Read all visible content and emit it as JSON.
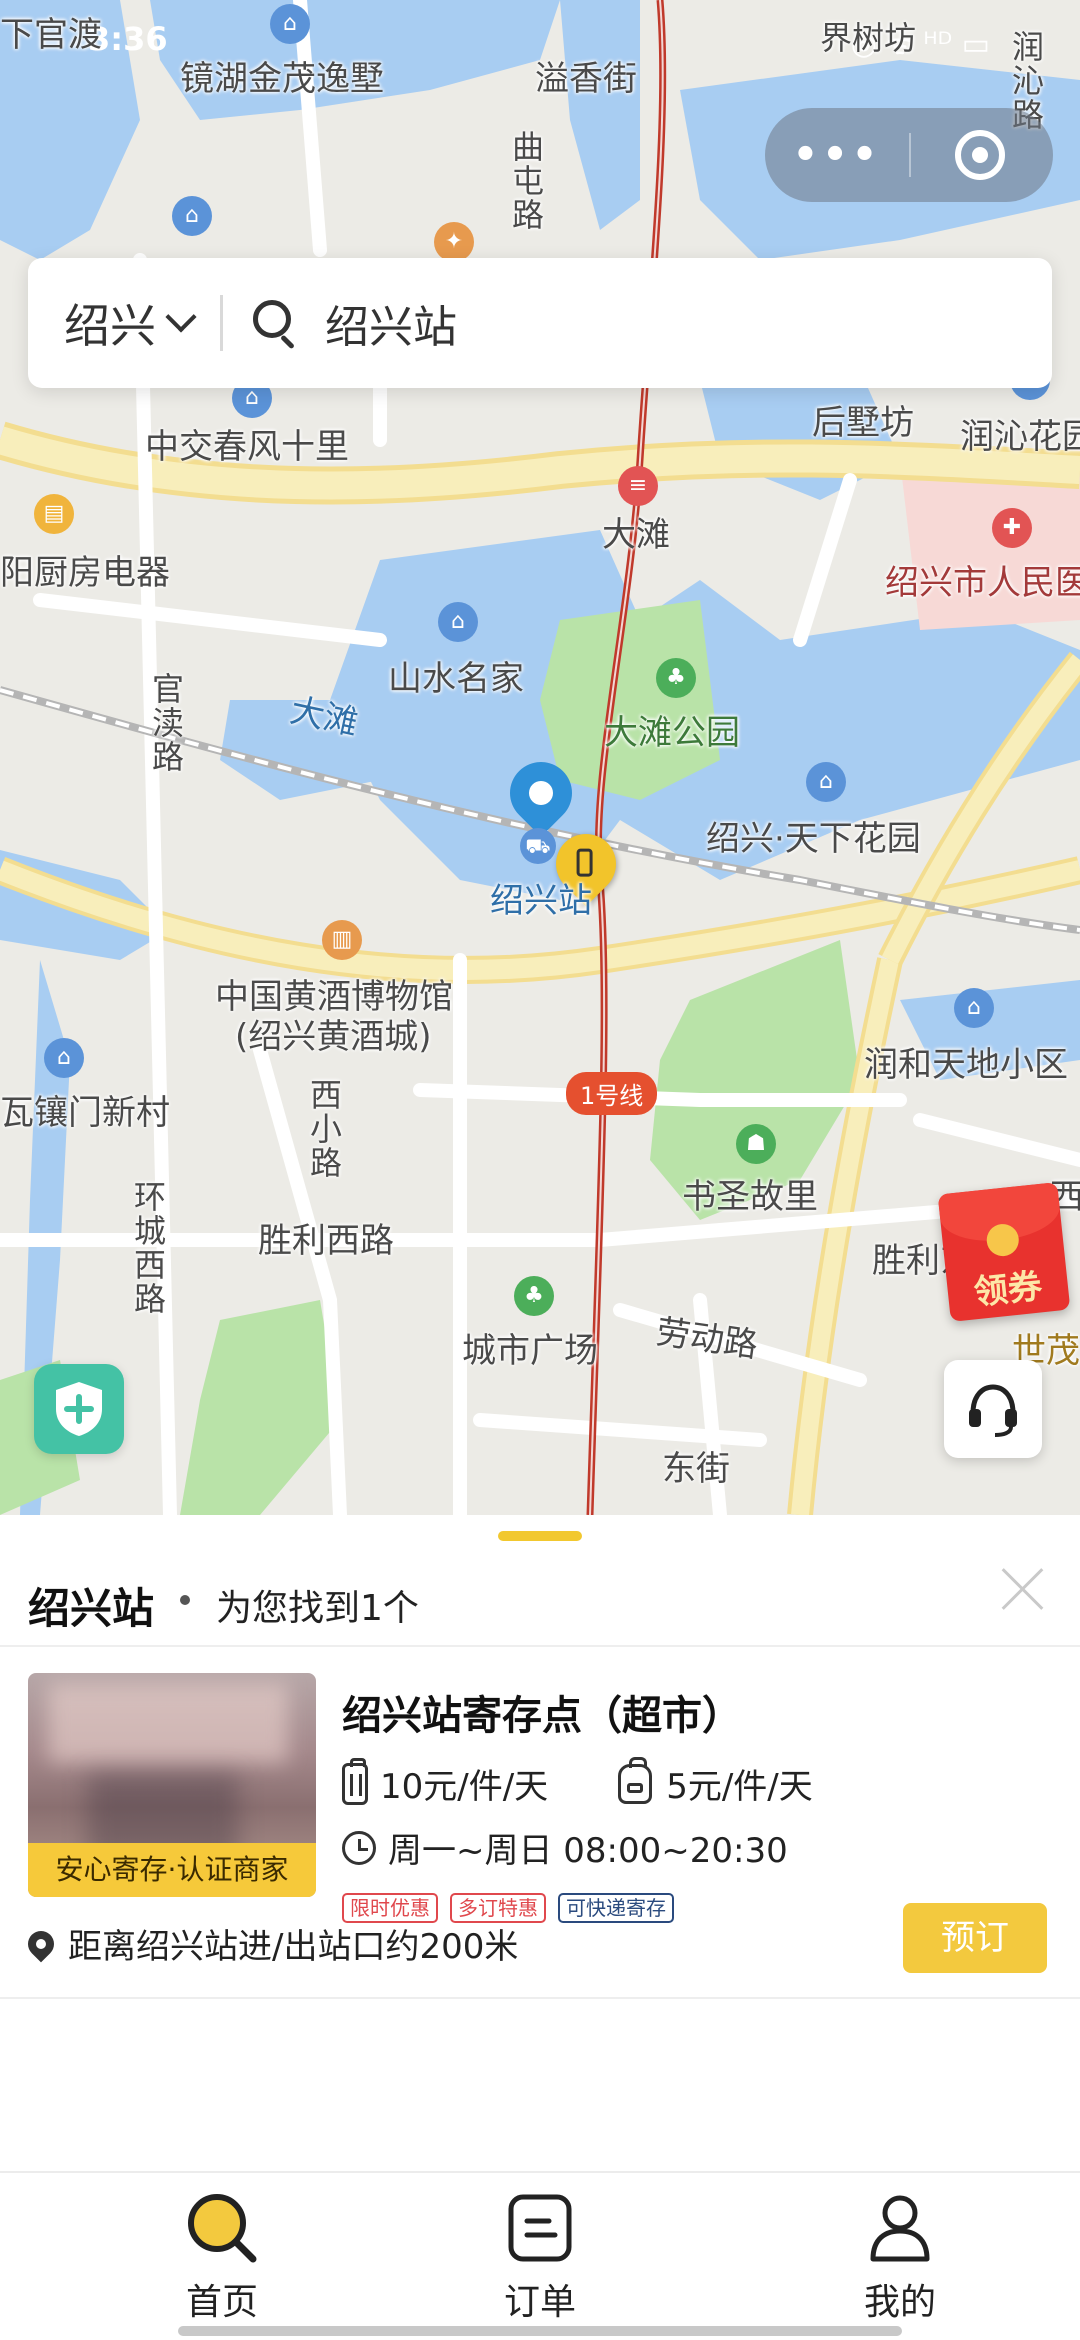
{
  "status_bar": {
    "time": "3:36",
    "icons": "◎ ᯤ ᴴᴰ ▭"
  },
  "capsule": {
    "more": "•••",
    "close_icon": "target-icon"
  },
  "search": {
    "city": "绍兴",
    "query": "绍兴站"
  },
  "map": {
    "labels": {
      "xiaguanshu": "下官渡",
      "jinghu": "镜湖金茂逸墅",
      "yixiangjie": "溢香街",
      "qutunlu": "曲屯路",
      "runqinlu": "润沁路",
      "jiecunfang": "界树坊",
      "zhongjiao": "中交春风十里",
      "houyefang": "后墅坊",
      "runqinhuayuan": "润沁花园",
      "datan_station": "大滩",
      "chufang": "阳厨房电器",
      "hospital": "绍兴市人民医院",
      "shanshui": "山水名家",
      "guandulu": "官渎路",
      "datan_water": "大滩",
      "datan_park": "大滩公园",
      "tianxia": "绍兴·天下花园",
      "shaoxing_station": "绍兴站",
      "museum1": "中国黄酒博物馆",
      "museum2": "(绍兴黄酒城)",
      "runhe": "润和天地小区",
      "yuanmen": "瓦镶门新村",
      "xixiaolu": "西小路",
      "line1": "1号线",
      "shushengguli": "书圣故里",
      "huanchengxilu": "环城西路",
      "shenglixilu": "胜利西路",
      "shengli": "胜利东",
      "shichang": "城市广场",
      "laodonglu": "劳动路",
      "dongjie": "东街",
      "shimao": "世茂",
      "xi": "西"
    }
  },
  "coupon": {
    "label": "领券"
  },
  "sheet": {
    "title": "绍兴站",
    "count_text": "为您找到1个",
    "results": [
      {
        "name": "绍兴站寄存点（超市）",
        "thumb_tag": "安心寄存·认证商家",
        "price_luggage": "10元/件/天",
        "price_bag": "5元/件/天",
        "hours": "周一~周日 08:00~20:30",
        "badges": [
          "限时优惠",
          "多订特惠",
          "可快递寄存"
        ],
        "distance": "距离绍兴站进/出站口约200米",
        "book_label": "预订"
      }
    ]
  },
  "tabs": [
    {
      "label": "首页",
      "icon": "home-search-icon",
      "active": true
    },
    {
      "label": "订单",
      "icon": "order-icon",
      "active": false
    },
    {
      "label": "我的",
      "icon": "profile-icon",
      "active": false
    }
  ],
  "colors": {
    "accent": "#f3c93e",
    "route": "#c0392b",
    "water": "#a8cdf2",
    "park": "#b9e3a8"
  }
}
